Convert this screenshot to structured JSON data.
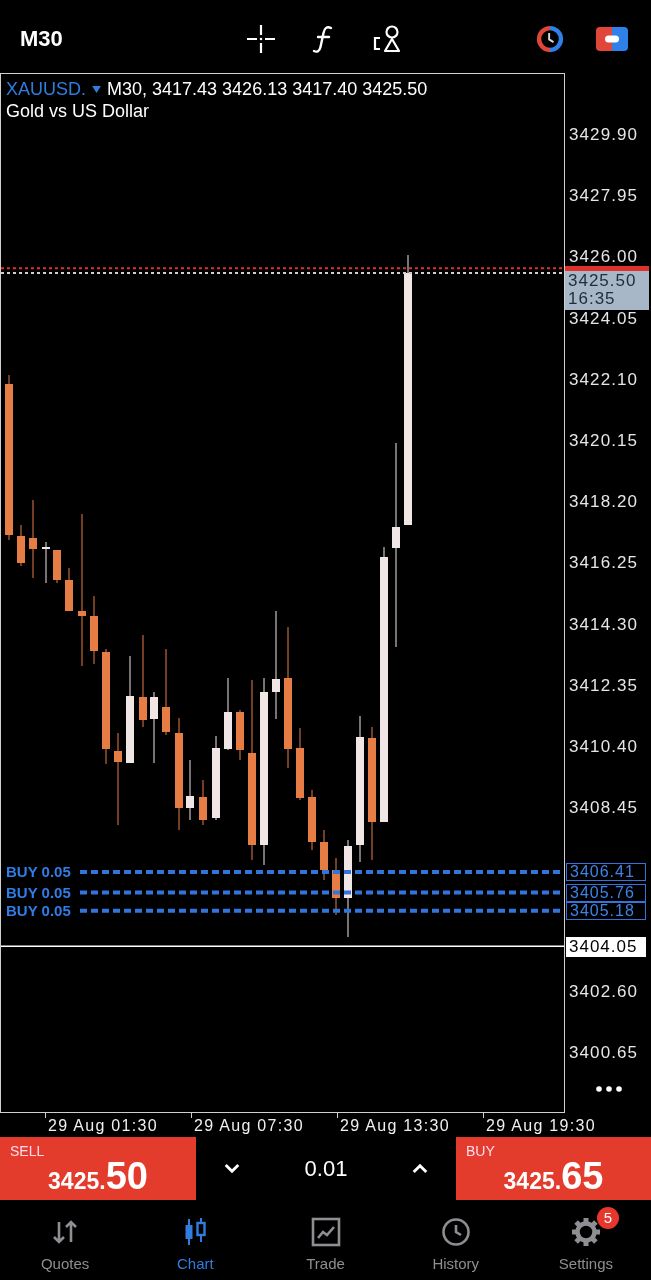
{
  "top_bar": {
    "timeframe": "M30"
  },
  "chart": {
    "symbol": "XAUUSD.",
    "ohlc": "M30, 3417.43 3426.13 3417.40 3425.50",
    "description": "Gold vs US Dollar",
    "price_axis": [
      "3429.90",
      "3427.95",
      "3426.00",
      "3424.05",
      "3422.10",
      "3420.15",
      "3418.20",
      "3416.25",
      "3414.30",
      "3412.35",
      "3410.40",
      "3408.45",
      "3402.60",
      "3400.65"
    ],
    "current_price": {
      "price": "3425.50",
      "countdown": "16:35"
    },
    "positions": [
      {
        "label": "BUY 0.05",
        "price": "3406.41"
      },
      {
        "label": "BUY 0.05",
        "price": "3405.76"
      },
      {
        "label": "BUY 0.05",
        "price": "3405.18"
      }
    ],
    "horizontal_line": {
      "price": "3404.05"
    },
    "time_axis": [
      "29 Aug 01:30",
      "29 Aug 07:30",
      "29 Aug 13:30",
      "29 Aug 19:30"
    ]
  },
  "trade_bar": {
    "sell": {
      "label": "SELL",
      "price_head": "3425.",
      "price_tail": "50"
    },
    "volume": "0.01",
    "buy": {
      "label": "BUY",
      "price_head": "3425.",
      "price_tail": "65"
    }
  },
  "nav": [
    {
      "label": "Quotes",
      "selected": false
    },
    {
      "label": "Chart",
      "selected": true
    },
    {
      "label": "Trade",
      "selected": false
    },
    {
      "label": "History",
      "selected": false
    },
    {
      "label": "Settings",
      "selected": false,
      "badge": "5"
    }
  ]
}
